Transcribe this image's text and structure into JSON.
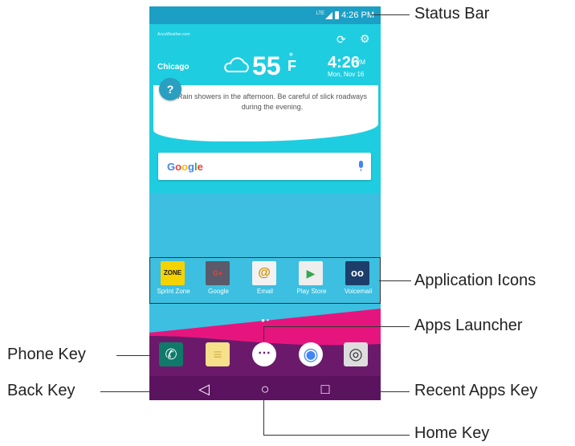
{
  "status_bar": {
    "network": "LTE",
    "time": "4:26 PM"
  },
  "weather": {
    "source": "AccuWeather.com",
    "city": "Chicago",
    "temperature": "55",
    "unit": "F",
    "degree": "°",
    "clock_time": "4:26",
    "clock_ampm": "PM",
    "clock_date": "Mon, Nov 16",
    "forecast": "Rain showers in the afternoon. Be careful of slick roadways during the evening.",
    "help_symbol": "?"
  },
  "search": {
    "logo": "Google"
  },
  "apps": [
    {
      "label": "Sprint Zone",
      "icon": "sprint-zone-icon",
      "badge": "ZONE",
      "color": "#f4d300"
    },
    {
      "label": "Google",
      "icon": "google-folder-icon",
      "badge": "G+",
      "color": "#5a5a6a"
    },
    {
      "label": "Email",
      "icon": "email-icon",
      "badge": "@",
      "color": "#f2f2f2"
    },
    {
      "label": "Play Store",
      "icon": "play-store-icon",
      "badge": "▶",
      "color": "#eeeeee"
    },
    {
      "label": "Voicemail",
      "icon": "voicemail-icon",
      "badge": "oo",
      "color": "#1d3e6a"
    }
  ],
  "page_indicator": "● •",
  "dock": {
    "phone": "✆",
    "messaging": "≡",
    "apps": "⋯",
    "chrome": "◉",
    "camera": "◎"
  },
  "nav": {
    "back": "◁",
    "home": "○",
    "recent": "□"
  },
  "callouts": {
    "status_bar": "Status Bar",
    "application_icons": "Application Icons",
    "apps_launcher": "Apps Launcher",
    "phone_key": "Phone Key",
    "back_key": "Back Key",
    "recent_apps_key": "Recent Apps Key",
    "home_key": "Home Key"
  },
  "colors": {
    "sky": "#3cbfe0",
    "status_bar": "#1c9fc4",
    "weather": "#1fcde0",
    "magenta": "#e6157e",
    "purple": "#6b1a6b",
    "deep_purple": "#5b1360"
  }
}
